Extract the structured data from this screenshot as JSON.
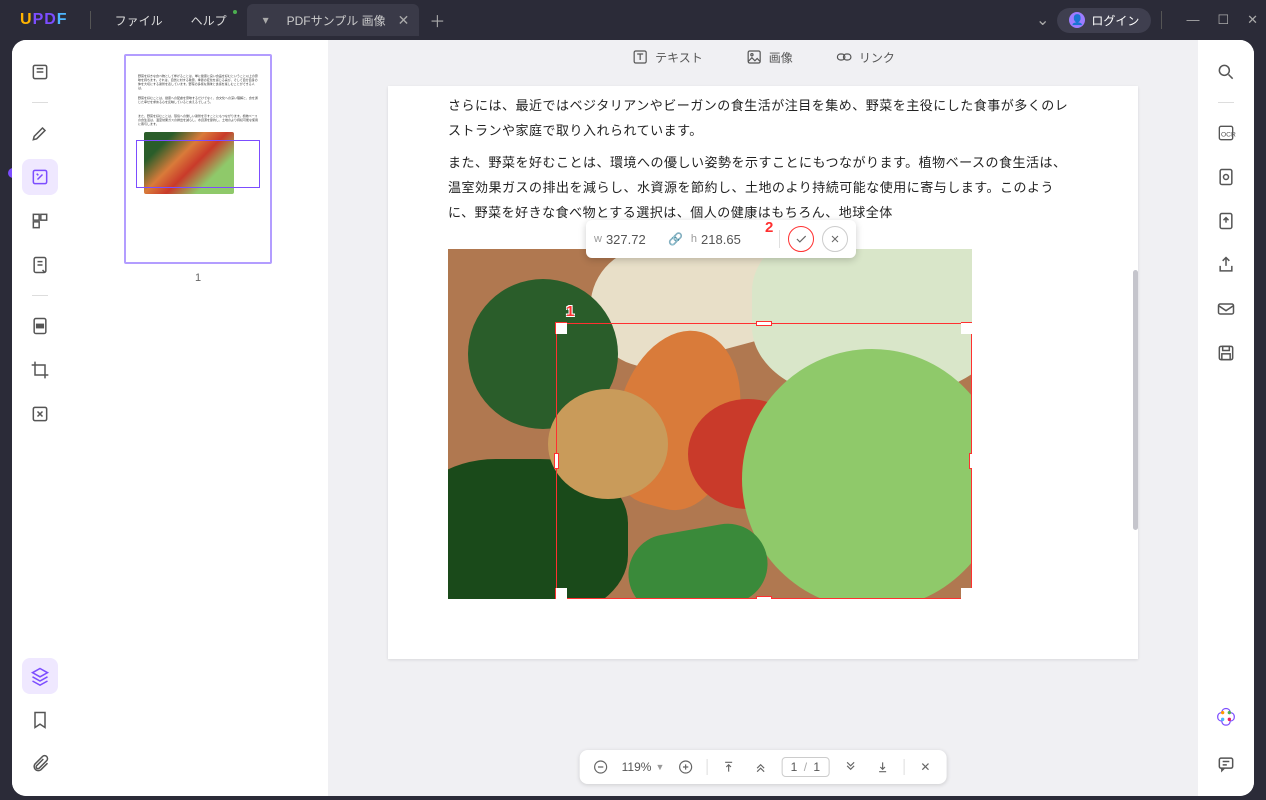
{
  "app": {
    "name": "UPDF"
  },
  "menu": {
    "file": "ファイル",
    "help": "ヘルプ"
  },
  "tab": {
    "title": "PDFサンプル 画像"
  },
  "login": {
    "label": "ログイン"
  },
  "top_tabs": {
    "text": "テキスト",
    "image": "画像",
    "link": "リンク"
  },
  "document": {
    "para1": "さらには、最近ではベジタリアンやビーガンの食生活が注目を集め、野菜を主役にした食事が多くのレストランや家庭で取り入れられています。",
    "para2": "また、野菜を好むことは、環境への優しい姿勢を示すことにもつながります。植物ベースの食生活は、温室効果ガスの排出を減らし、水資源を節約し、土地のより持続可能な使用に寄与します。このように、野菜を好きな食べ物とする選択は、個人の健康はもちろん、地球全体"
  },
  "size_popup": {
    "w_prefix": "w",
    "w_value": "327.72",
    "h_prefix": "h",
    "h_value": "218.65"
  },
  "annotations": {
    "one": "1",
    "two": "2"
  },
  "zoom": {
    "percent": "119%",
    "page_current": "1",
    "page_sep": "/",
    "page_total": "1"
  },
  "thumbnail": {
    "page_num": "1"
  }
}
